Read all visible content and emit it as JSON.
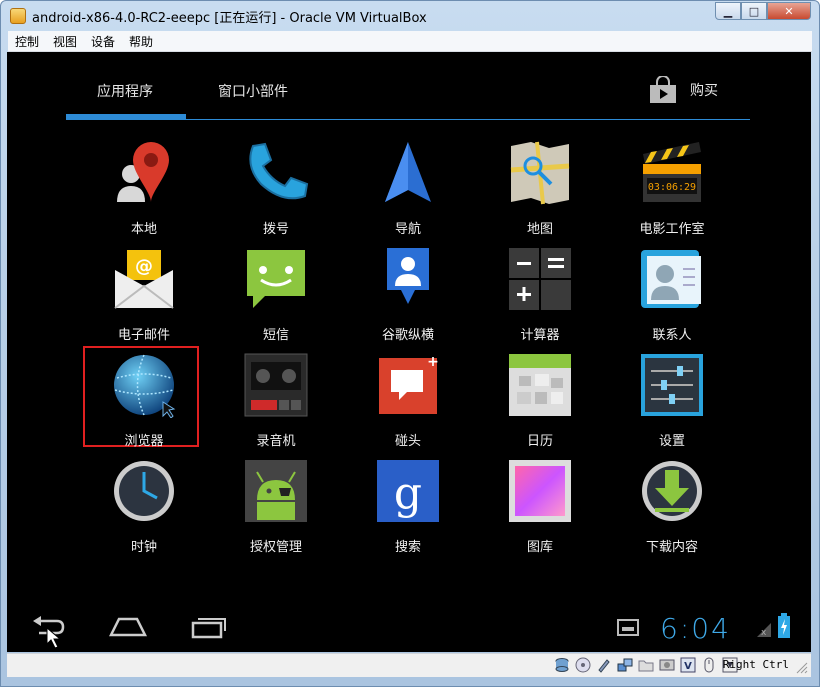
{
  "window": {
    "title": "android-x86-4.0-RC2-eeepc [正在运行] - Oracle VM VirtualBox",
    "controls": {
      "minimize": "▁",
      "maximize": "□",
      "close": "✕"
    }
  },
  "menubar": [
    "控制",
    "视图",
    "设备",
    "帮助"
  ],
  "launcher": {
    "tabs": [
      {
        "label": "应用程序",
        "selected": true
      },
      {
        "label": "窗口小部件",
        "selected": false
      }
    ],
    "shop_label": "购买",
    "accent_color": "#2d8bd6",
    "apps": [
      {
        "label": "本地",
        "icon": "maps-local-pin-icon"
      },
      {
        "label": "拨号",
        "icon": "phone-handset-icon"
      },
      {
        "label": "导航",
        "icon": "navigation-arrow-icon"
      },
      {
        "label": "地图",
        "icon": "map-icon"
      },
      {
        "label": "电影工作室",
        "icon": "clapperboard-icon"
      },
      {
        "label": "电子邮件",
        "icon": "email-envelope-icon"
      },
      {
        "label": "短信",
        "icon": "chat-bubble-icon"
      },
      {
        "label": "谷歌纵横",
        "icon": "latitude-person-icon"
      },
      {
        "label": "计算器",
        "icon": "calculator-icon"
      },
      {
        "label": "联系人",
        "icon": "contacts-icon"
      },
      {
        "label": "浏览器",
        "icon": "browser-globe-icon",
        "highlighted": true
      },
      {
        "label": "录音机",
        "icon": "sound-recorder-icon"
      },
      {
        "label": "碰头",
        "icon": "talk-bubble-icon"
      },
      {
        "label": "日历",
        "icon": "calendar-icon"
      },
      {
        "label": "设置",
        "icon": "settings-sliders-icon"
      },
      {
        "label": "时钟",
        "icon": "clock-icon"
      },
      {
        "label": "授权管理",
        "icon": "android-superuser-icon"
      },
      {
        "label": "搜索",
        "icon": "google-search-icon"
      },
      {
        "label": "图库",
        "icon": "gallery-icon"
      },
      {
        "label": "下载内容",
        "icon": "download-arrow-icon"
      }
    ]
  },
  "navbar": {
    "time": "6:04"
  },
  "statusbar": {
    "host_key": "Right Ctrl"
  }
}
